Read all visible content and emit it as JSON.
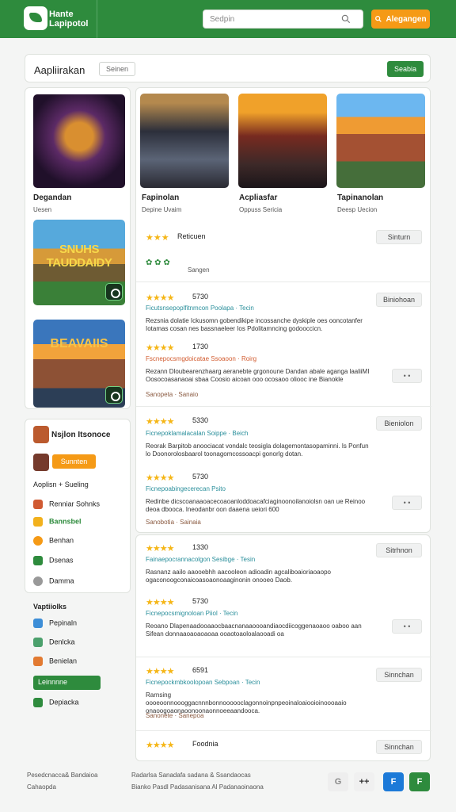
{
  "brand": {
    "title_line1": "Hante",
    "title_line2": "Lapipotol"
  },
  "search": {
    "placeholder": "Sedpin",
    "button": "Alegangen"
  },
  "title": {
    "heading": "Aapliirakan",
    "chip": "Seinen",
    "action": "Seabia"
  },
  "left_cards": {
    "card1": {
      "name": "Degandan",
      "sub": "Uesen"
    },
    "card2": {
      "banner": "SNUHS TAUDDAIDY"
    },
    "card3": {
      "banner": "BEAVAIIS"
    }
  },
  "left_panel": {
    "title": "Nsjlon Itsonoce",
    "button": "Sunnten",
    "items": [
      {
        "label": "Aoplisn + Sueling"
      },
      {
        "label": "Renniar Sohnks"
      },
      {
        "label": "Bannsbel"
      },
      {
        "label": "Benhan"
      },
      {
        "label": "Dsenas"
      },
      {
        "label": "Damma"
      }
    ]
  },
  "sidebar": {
    "title": "Vaptiiolks",
    "items": [
      {
        "label": "Pepinaln"
      },
      {
        "label": "Denlcka"
      },
      {
        "label": "Benielan"
      },
      {
        "label": "Leinnnne"
      },
      {
        "label": "Depiacka"
      }
    ]
  },
  "games": [
    {
      "title": "Fapinolan",
      "sub": "Depine Uvaim"
    },
    {
      "title": "Acpliasfar",
      "sub": "Oppuss Sericia"
    },
    {
      "title": "Tapinanolan",
      "sub": "Deesp Uecion"
    }
  ],
  "review_header": {
    "title": "Reticuen",
    "sub": "Sangen"
  },
  "reviews": [
    {
      "rating": "5730",
      "reviewer": "Ficutsnsepoplfitnmcon Poolapa · Tecin",
      "text": "Rezsnia dolatie Ickusomn gobendikipe incossanche dyskiple oes ooncotanfer Iotamas cosan nes bassnaeleer Ios Pdolitamncing godooccicn.",
      "button": "Sinturn"
    },
    {
      "rating": "1730",
      "reviewer": "Fscnepocsmgdoicatae Ssoaoon · Roirg",
      "text": "Rezann Dloubearenzhaarg aeranebte grgonoune Dandan abale aganga laaliiMI Oosocoasanaoai sbaa Coosio aicoan ooo ocosaoo oliooc ine Bianokle",
      "button": "Biniohoan"
    },
    {
      "rating": "5330",
      "reviewer": "Ficnepoklamalacalan Soippe · Beich",
      "text": "Reorak Barpitob anoociacat vondalc teosigla dolagemontasopaminni. Is Ponfun lo Doonorolosbaarol toonagomcossoacpi gonorlg dotan.",
      "button": "Bieniolon"
    },
    {
      "rating": "5730",
      "reviewer": "Ficnepoabingecerecan Psito",
      "text": "Redinbe dicscoanaaoacecoaoanloddoacafciaginoonoilanoiolsn oan ue Reinoo deoa dbooca. Ineodanbr oon daaena ueiori 600",
      "button": "Sitrhnon"
    },
    {
      "rating": "1330",
      "reviewer": "Fainaepocrannacolgon Sesibge · Tesin",
      "text": "Rasnanz aailo aaooebhh aacooleon adioadin agcaliboaioriaoaopo ogaconoogconaicoasoaonoaaginonin onooeo Daob.",
      "button": "Sinnchan"
    },
    {
      "rating": "5730",
      "reviewer": "Ficnepocsmignoloan Piiol · Tecin",
      "text": "Reoano Dlapenaadooaaocbaacnanaaoooandiaocdiicoggenaoaoo oaboo aan Sifean donnaaoaoaoaoaa ooaotoaoloalaooadi oa",
      "button": "Sinnedan"
    },
    {
      "rating": "6591",
      "reviewer": "Ficnepockmbkoolopoan Sebpoan · Tecin",
      "text": "Rarnsing oooeoonnoooggacnnnbonnoooooclagonnoinpnpeoinaloaiooioinoooaaio onaoogoaonaoonoonaonnoeeaandooca.",
      "button": "Sinnchan"
    },
    {
      "rating": "Foodnia",
      "reviewer": "",
      "text": "",
      "button": "Sinnchan"
    }
  ],
  "review_meta": [
    {
      "a": "Sanopeta",
      "b": "Sanaio"
    },
    {
      "a": "Sanobotia",
      "b": "Sainaia"
    },
    {
      "a": "Sanonete",
      "b": "Sanepoa"
    },
    {
      "a": "Sanoetn",
      "b": "Sanaia"
    },
    {
      "a": "Sanopta",
      "b": "Saneia"
    }
  ],
  "footer": {
    "line1": "Pesedcnacca& Bandaioa",
    "line2": "Cahaopda",
    "center1": "Radarlsa Sanadafa sadana & Ssandaocas",
    "center2": "Bianko Pasdl Padasanisana Al Padanaoinaona",
    "btn_gray": "G",
    "btn_arrows": "++",
    "btn_blue": "F",
    "btn_green": "F"
  }
}
